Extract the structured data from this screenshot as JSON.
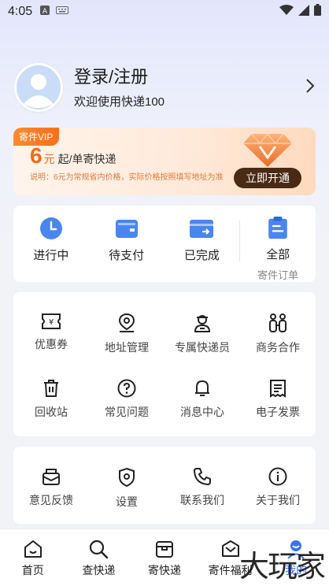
{
  "status_bar": {
    "time": "4:05"
  },
  "profile": {
    "title": "登录/注册",
    "subtitle": "欢迎使用快递100"
  },
  "vip": {
    "tag": "寄件VIP",
    "price_num": "6",
    "price_unit": "元",
    "price_suffix": "起/单寄快递",
    "note": "说明：6元为常规省内价格，实际价格按照填写地址为准",
    "button": "立即开通"
  },
  "orders": [
    {
      "label": "进行中",
      "icon": "clock-icon"
    },
    {
      "label": "待支付",
      "icon": "wallet-icon"
    },
    {
      "label": "已完成",
      "icon": "card-icon"
    },
    {
      "label": "全部",
      "sub": "寄件订单",
      "icon": "clipboard-icon"
    }
  ],
  "tools": [
    {
      "label": "优惠券",
      "icon": "coupon-icon"
    },
    {
      "label": "地址管理",
      "icon": "location-icon"
    },
    {
      "label": "专属快递员",
      "icon": "courier-icon"
    },
    {
      "label": "商务合作",
      "icon": "partners-icon"
    },
    {
      "label": "回收站",
      "icon": "trash-icon"
    },
    {
      "label": "常见问题",
      "icon": "question-icon"
    },
    {
      "label": "消息中心",
      "icon": "bell-icon"
    },
    {
      "label": "电子发票",
      "icon": "invoice-icon"
    }
  ],
  "tools2": [
    {
      "label": "意见反馈",
      "icon": "feedback-icon"
    },
    {
      "label": "设置",
      "icon": "settings-icon"
    },
    {
      "label": "联系我们",
      "icon": "phone-icon"
    },
    {
      "label": "关于我们",
      "icon": "info-icon"
    }
  ],
  "nav": [
    {
      "label": "首页",
      "icon": "home-icon"
    },
    {
      "label": "查快递",
      "icon": "search-icon"
    },
    {
      "label": "寄快递",
      "icon": "box-icon"
    },
    {
      "label": "寄件福利",
      "icon": "gift-icon"
    },
    {
      "label": "我的",
      "icon": "profile-icon"
    }
  ],
  "watermark": "大玩家",
  "colors": {
    "accent": "#3a73f0",
    "vip_orange": "#f06a13",
    "vip_button": "#4a2a14"
  }
}
